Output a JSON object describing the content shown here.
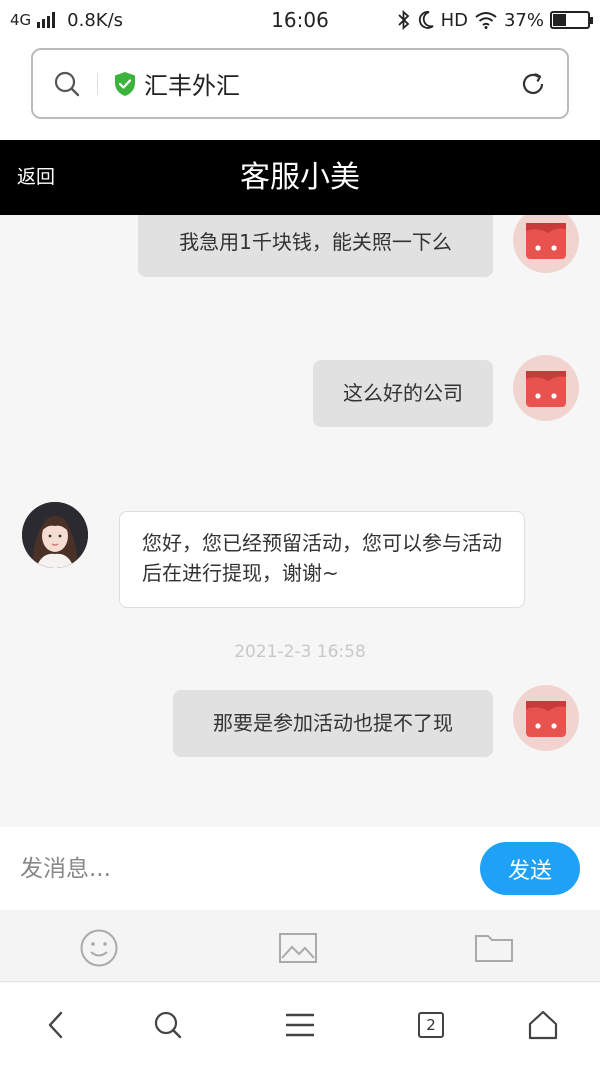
{
  "status_bar": {
    "network": "4G",
    "speed": "0.8K/s",
    "time": "16:06",
    "hd": "HD",
    "battery": "37%",
    "battery_level": 0.37
  },
  "browser": {
    "site_title": "汇丰外汇",
    "tab_count": "2"
  },
  "chat": {
    "back_label": "返回",
    "title": "客服小美",
    "messages": [
      {
        "sender": "user",
        "text": "我急用1千块钱，能关照一下么"
      },
      {
        "sender": "user",
        "text": "这么好的公司"
      },
      {
        "sender": "agent",
        "text": "您好，您已经预留活动，您可以参与活动后在进行提现，谢谢~"
      },
      {
        "sender": "user",
        "text": "那要是参加活动也提不了现",
        "timestamp": "2021-2-3 16:58"
      }
    ]
  },
  "composer": {
    "placeholder": "发消息...",
    "send_label": "发送"
  },
  "icons": {
    "search": "search-icon",
    "shield": "shield-check-icon",
    "reload": "reload-icon",
    "emoji": "emoji-icon",
    "image": "image-icon",
    "folder": "folder-icon",
    "back": "chevron-left-icon",
    "menu": "menu-icon",
    "home": "home-icon"
  },
  "colors": {
    "accent": "#1ea1f7",
    "shield": "#3cb43c",
    "header_bg": "#000000",
    "user_bubble": "#e1e1e1",
    "user_avatar": "#e8524f"
  }
}
